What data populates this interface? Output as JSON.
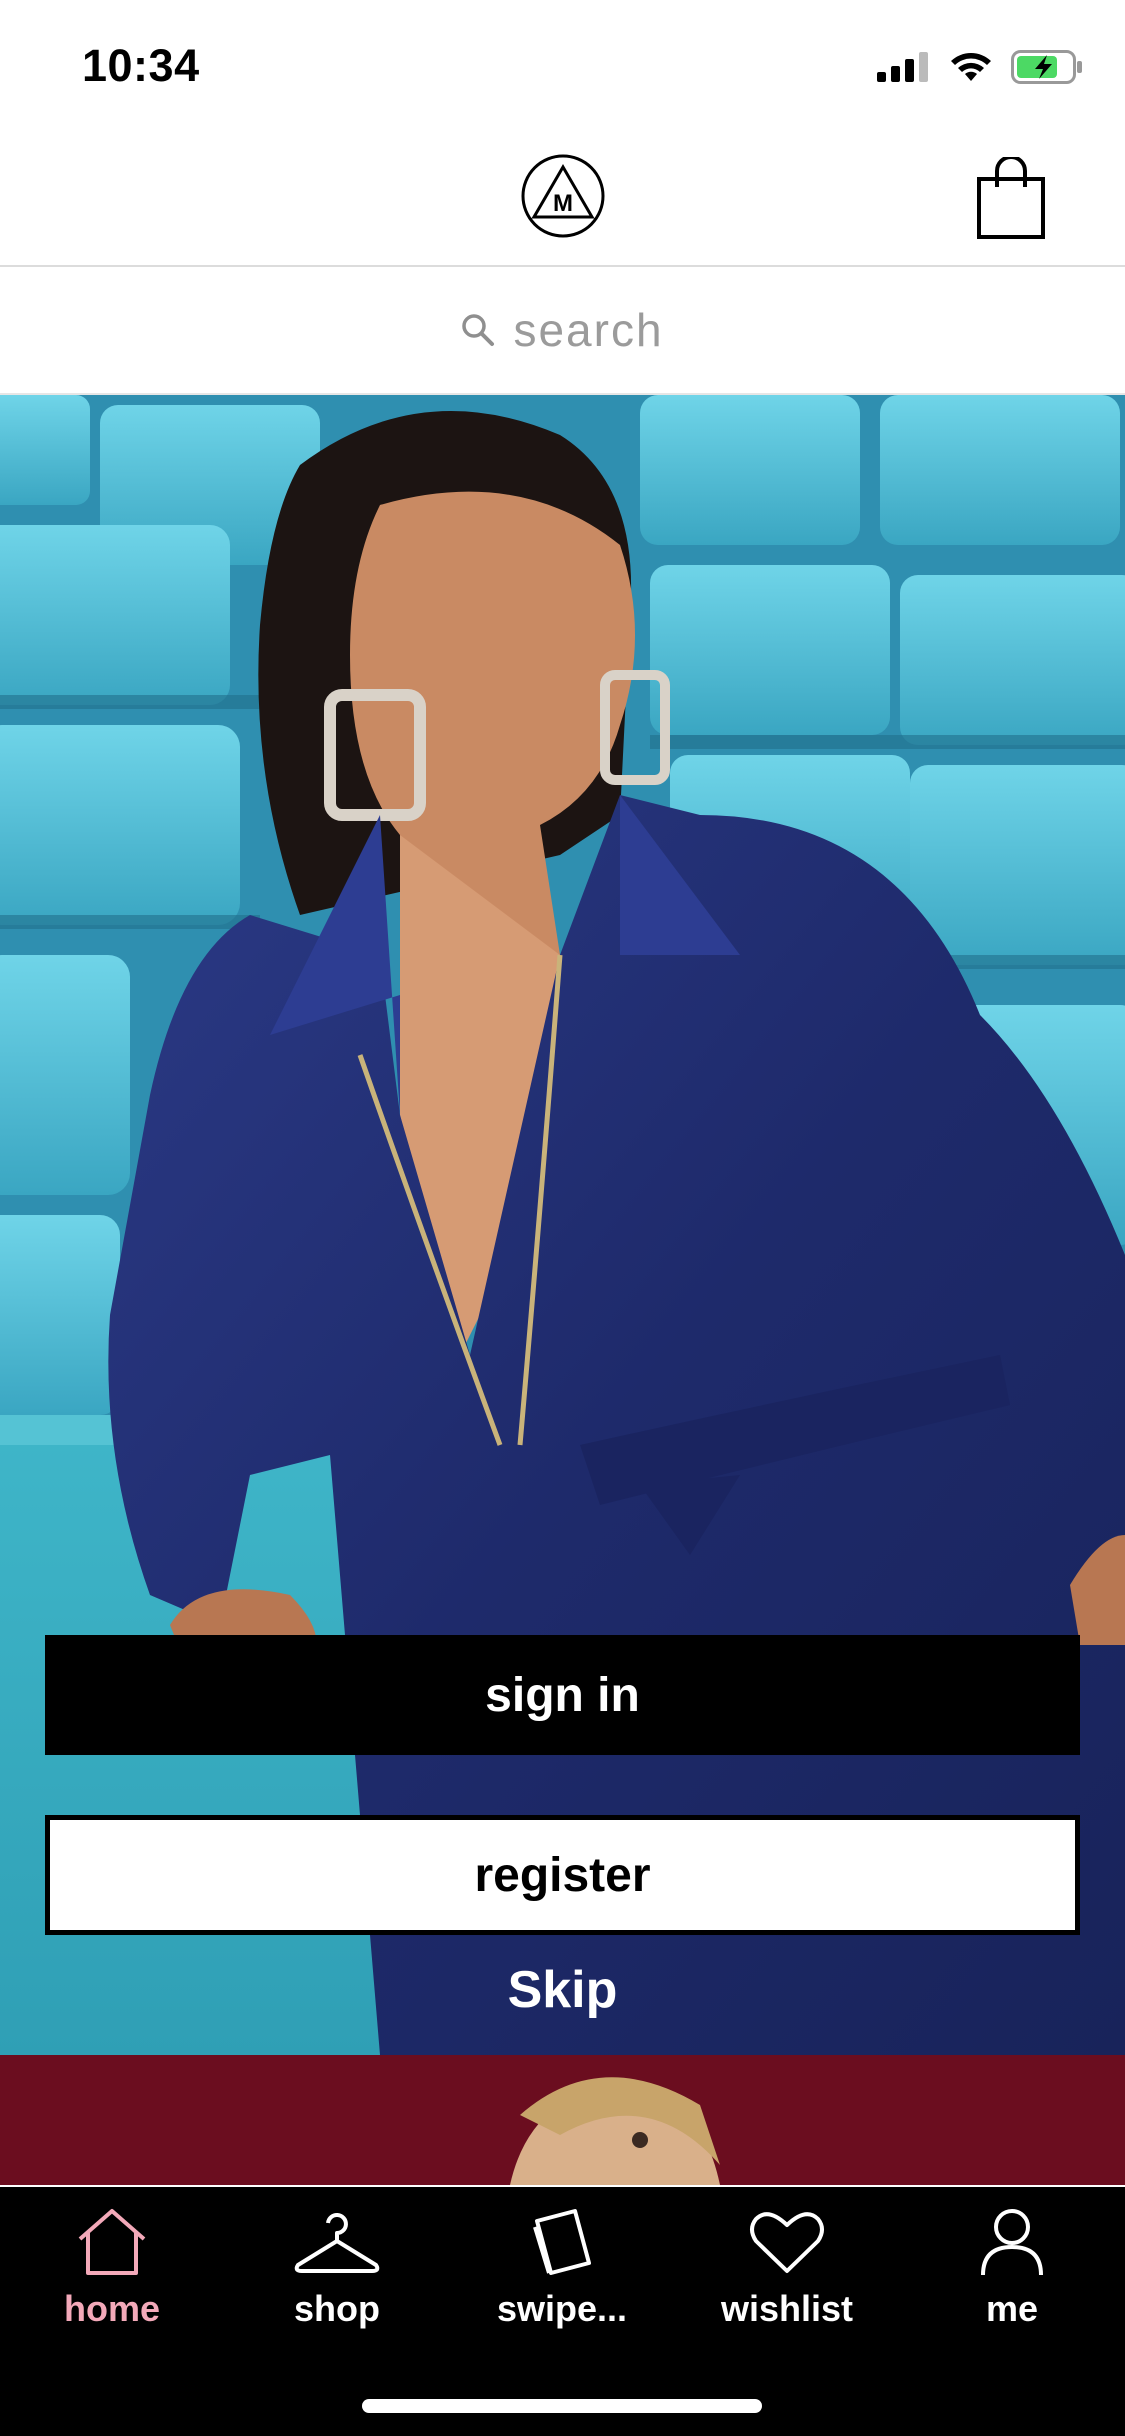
{
  "status_bar": {
    "time": "10:34"
  },
  "header": {
    "logo_icon": "missguided-m-triangle-logo",
    "bag_icon": "shopping-bag-icon"
  },
  "search": {
    "placeholder": "search",
    "icon": "search-icon"
  },
  "auth": {
    "sign_in_label": "sign in",
    "register_label": "register",
    "skip_label": "Skip"
  },
  "tabbar": {
    "items": [
      {
        "label": "home",
        "icon": "home-icon",
        "active": true
      },
      {
        "label": "shop",
        "icon": "hanger-icon",
        "active": false
      },
      {
        "label": "swipe...",
        "icon": "cards-icon",
        "active": false
      },
      {
        "label": "wishlist",
        "icon": "heart-icon",
        "active": false
      },
      {
        "label": "me",
        "icon": "person-icon",
        "active": false
      }
    ]
  },
  "colors": {
    "accent_active_tab": "#f3a9b9",
    "promo_background": "#6b0d1f",
    "tabbar_background": "#000000",
    "battery_green": "#4cd964"
  }
}
